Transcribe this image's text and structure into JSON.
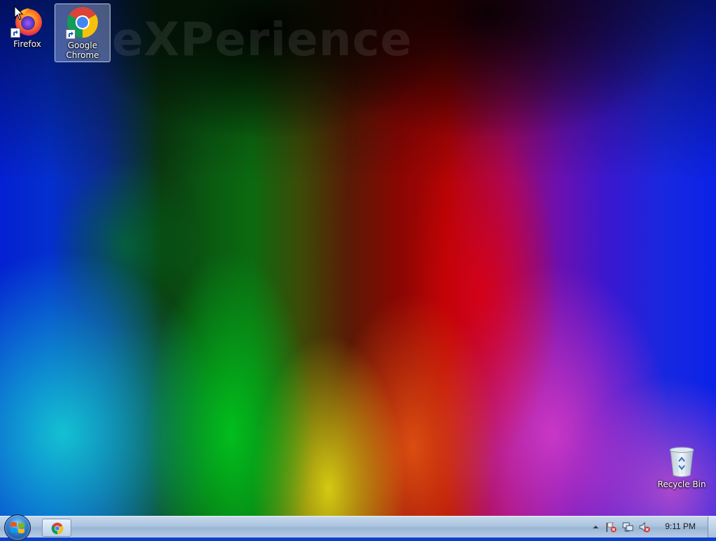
{
  "desktop": {
    "wallpaper_watermark": "eXPerience",
    "icons": [
      {
        "label": "Firefox",
        "selected": false
      },
      {
        "label": "Google Chrome",
        "label_line1": "Google",
        "label_line2": "Chrome",
        "selected": true
      },
      {
        "label": "Recycle Bin",
        "selected": false
      }
    ]
  },
  "taskbar": {
    "start_button": "start-orb",
    "pinned": [
      {
        "app": "Google Chrome",
        "icon": "chrome-icon"
      }
    ],
    "tray": {
      "icons": [
        "show-hidden-icons-arrow",
        "action-center-flag-icon",
        "network-icon",
        "volume-muted-icon"
      ],
      "clock": "9:11 PM"
    }
  },
  "colors": {
    "taskbar": "#aac3de",
    "selection": "#c8dcff"
  }
}
